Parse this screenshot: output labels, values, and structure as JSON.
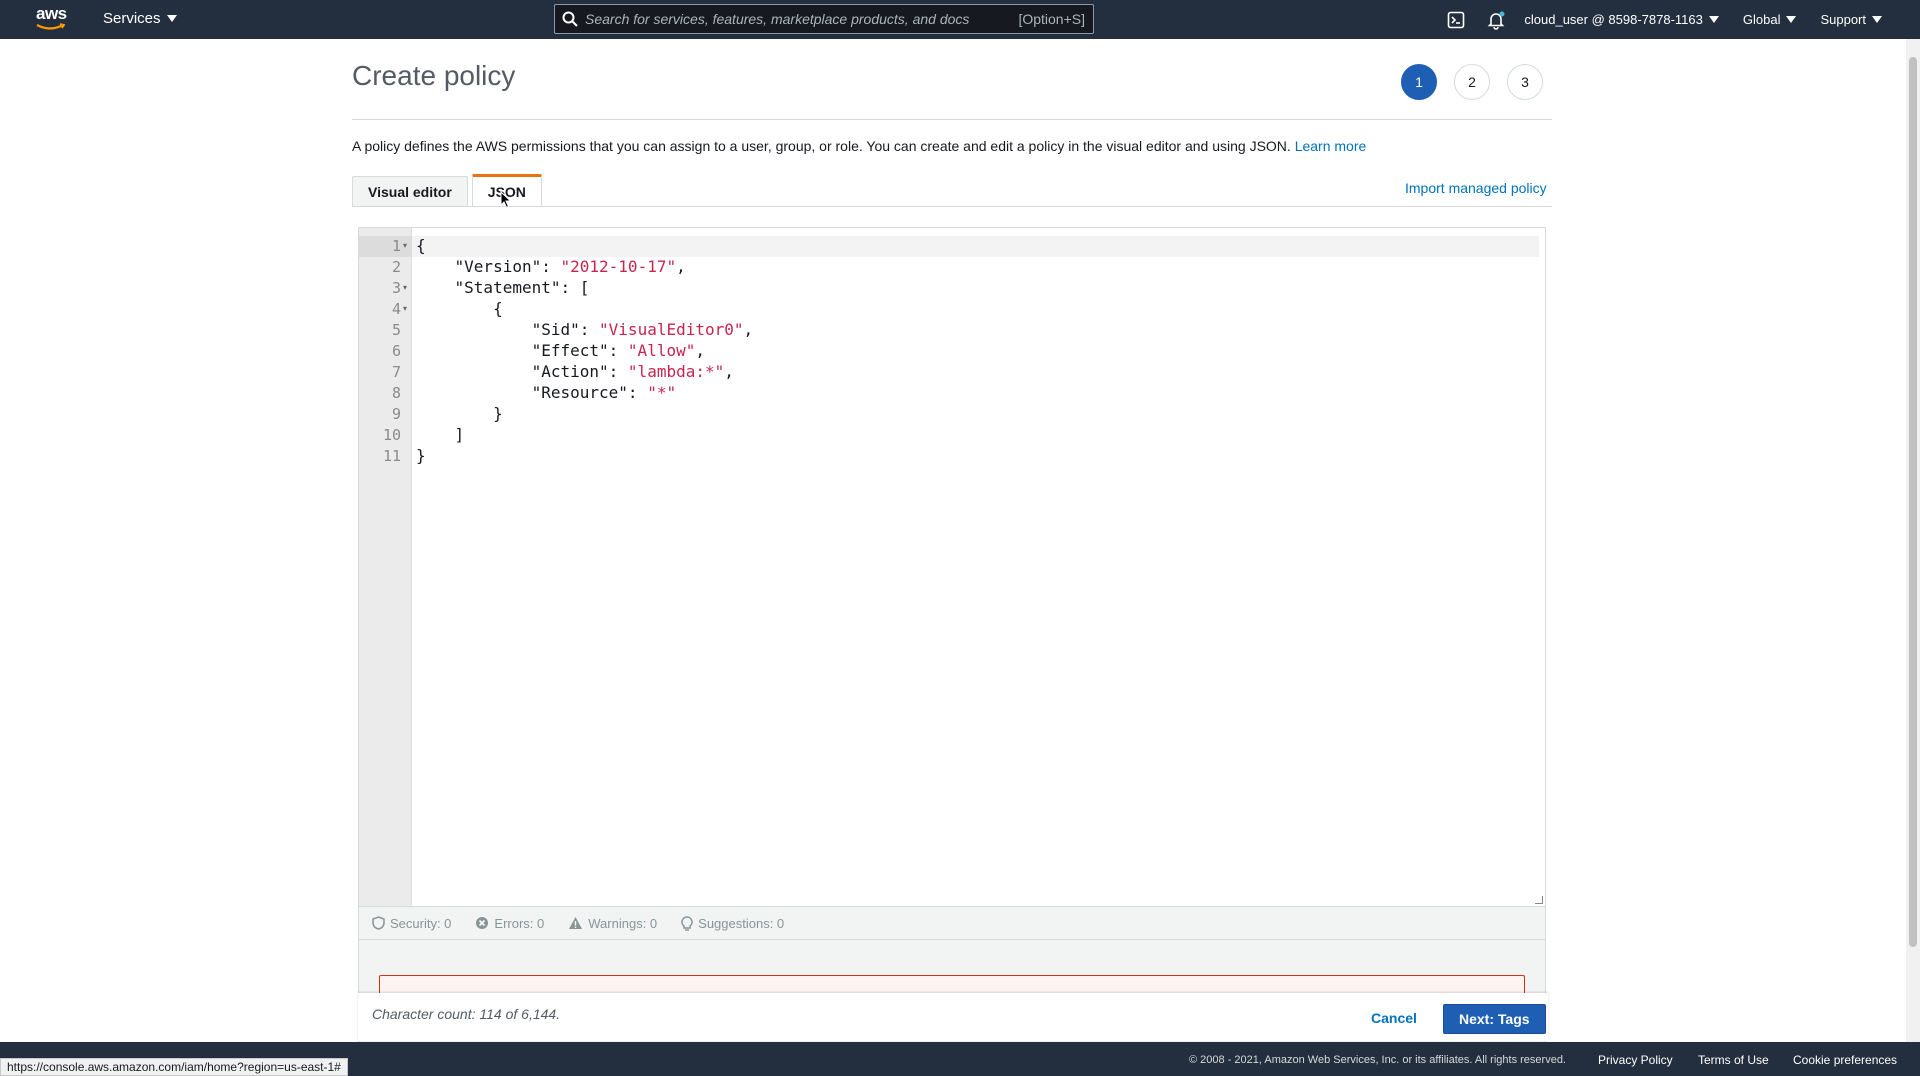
{
  "topnav": {
    "logo_text": "aws",
    "services_label": "Services",
    "search_placeholder": "Search for services, features, marketplace products, and docs",
    "search_shortcut": "[Option+S]",
    "account_label": "cloud_user @ 8598-7878-1163",
    "region_label": "Global",
    "support_label": "Support"
  },
  "page": {
    "title": "Create policy",
    "steps": [
      "1",
      "2",
      "3"
    ],
    "active_step": "1",
    "description": "A policy defines the AWS permissions that you can assign to a user, group, or role. You can create and edit a policy in the visual editor and using JSON.",
    "learn_more": "Learn more",
    "tabs": [
      {
        "label": "Visual editor",
        "active": false
      },
      {
        "label": "JSON",
        "active": true
      }
    ],
    "import_link": "Import managed policy"
  },
  "editor": {
    "line_numbers": [
      "1",
      "2",
      "3",
      "4",
      "5",
      "6",
      "7",
      "8",
      "9",
      "10",
      "11"
    ],
    "lines": [
      {
        "indent": "",
        "key": "",
        "punct": "{",
        "val": "",
        "tail": ""
      },
      {
        "indent": "    ",
        "key": "\"Version\": ",
        "punct": "",
        "val": "\"2012-10-17\"",
        "tail": ","
      },
      {
        "indent": "    ",
        "key": "\"Statement\": ",
        "punct": "[",
        "val": "",
        "tail": ""
      },
      {
        "indent": "        ",
        "key": "",
        "punct": "{",
        "val": "",
        "tail": ""
      },
      {
        "indent": "            ",
        "key": "\"Sid\": ",
        "punct": "",
        "val": "\"VisualEditor0\"",
        "tail": ","
      },
      {
        "indent": "            ",
        "key": "\"Effect\": ",
        "punct": "",
        "val": "\"Allow\"",
        "tail": ","
      },
      {
        "indent": "            ",
        "key": "\"Action\": ",
        "punct": "",
        "val": "\"lambda:*\"",
        "tail": ","
      },
      {
        "indent": "            ",
        "key": "\"Resource\": ",
        "punct": "",
        "val": "\"*\"",
        "tail": ""
      },
      {
        "indent": "        ",
        "key": "",
        "punct": "}",
        "val": "",
        "tail": ""
      },
      {
        "indent": "    ",
        "key": "",
        "punct": "]",
        "val": "",
        "tail": ""
      },
      {
        "indent": "",
        "key": "",
        "punct": "}",
        "val": "",
        "tail": ""
      }
    ],
    "foldable_lines": [
      1,
      3,
      4
    ]
  },
  "status": {
    "security": "Security: 0",
    "errors": "Errors: 0",
    "warnings": "Warnings: 0",
    "suggestions": "Suggestions: 0"
  },
  "action_bar": {
    "char_count": "Character count: 114 of 6,144.",
    "cancel_label": "Cancel",
    "next_label": "Next: Tags"
  },
  "footer": {
    "copyright": "© 2008 - 2021, Amazon Web Services, Inc. or its affiliates. All rights reserved.",
    "privacy": "Privacy Policy",
    "terms": "Terms of Use",
    "cookies": "Cookie preferences",
    "status_url": "https://console.aws.amazon.com/iam/home?region=us-east-1#"
  },
  "colors": {
    "nav_bg": "#232f3e",
    "primary_blue": "#1e5fb4",
    "link_blue": "#0073bb",
    "tab_accent": "#ec7211",
    "string_color": "#c7254e"
  }
}
